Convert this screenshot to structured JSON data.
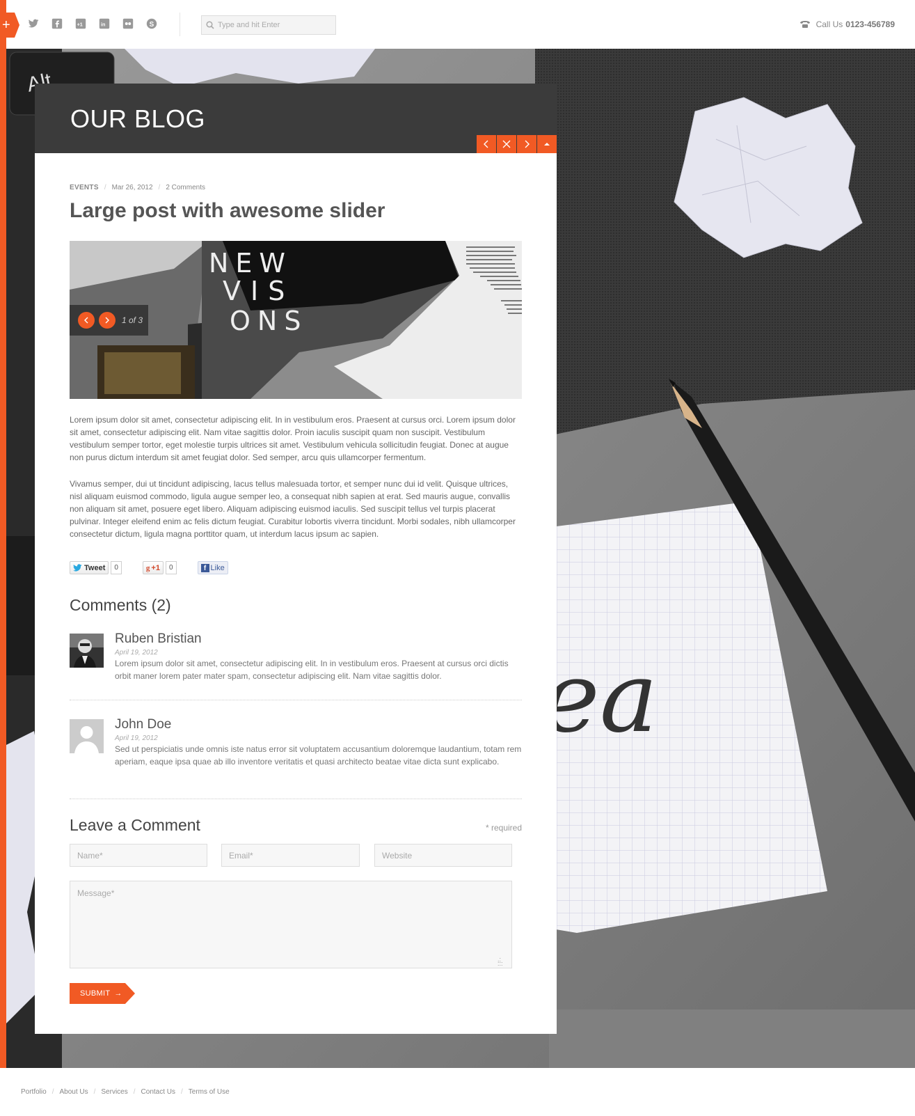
{
  "header": {
    "search_placeholder": "Type and hit Enter",
    "call_label": "Call Us",
    "phone": "0123-456789",
    "socials": [
      "twitter-icon",
      "facebook-icon",
      "google-plus-icon",
      "linkedin-icon",
      "flickr-icon",
      "skype-icon"
    ]
  },
  "blog": {
    "title": "OUR BLOG",
    "controls": [
      "previous-arrow-icon",
      "close-icon",
      "next-arrow-icon",
      "scroll-up-icon"
    ]
  },
  "post": {
    "category": "EVENTS",
    "date": "Mar 26, 2012",
    "comments_link": "2 Comments",
    "title": "Large post with awesome slider",
    "slider_counter": "1 of 3",
    "slider_text": {
      "line1": "NEW",
      "line2": "VIS",
      "line3": "ONS"
    },
    "paragraphs": [
      "Lorem ipsum dolor sit amet, consectetur adipiscing elit. In in vestibulum eros. Praesent at cursus orci. Lorem ipsum dolor sit amet, consectetur adipiscing elit. Nam vitae sagittis dolor. Proin iaculis suscipit quam non suscipit. Vestibulum vestibulum semper tortor, eget molestie turpis ultrices sit amet. Vestibulum vehicula sollicitudin feugiat. Donec at augue non purus dictum interdum sit amet feugiat dolor. Sed semper, arcu quis ullamcorper fermentum.",
      "Vivamus semper, dui ut tincidunt adipiscing, lacus tellus malesuada tortor, et semper nunc dui id velit. Quisque ultrices, nisl aliquam euismod commodo, ligula augue semper leo, a consequat nibh sapien at erat. Sed mauris augue, convallis non aliquam sit amet, posuere eget libero. Aliquam adipiscing euismod iaculis. Sed suscipit tellus vel turpis placerat pulvinar. Integer eleifend enim ac felis dictum feugiat. Curabitur lobortis viverra tincidunt. Morbi sodales, nibh ullamcorper consectetur dictum, ligula magna porttitor quam, ut interdum lacus ipsum ac sapien."
    ]
  },
  "share": {
    "tweet_label": "Tweet",
    "tweet_count": "0",
    "gplus_label": "+1",
    "gplus_count": "0",
    "like_label": "Like"
  },
  "comments": {
    "heading": "Comments (2)",
    "items": [
      {
        "name": "Ruben Bristian",
        "date": "April 19, 2012",
        "text": "Lorem ipsum dolor sit amet, consectetur adipiscing elit. In in vestibulum eros. Praesent at cursus orci dictis orbit maner lorem pater mater spam, consectetur adipiscing elit. Nam vitae sagittis dolor."
      },
      {
        "name": "John Doe",
        "date": "April 19, 2012",
        "text": "Sed ut perspiciatis unde omnis iste natus error sit voluptatem accusantium doloremque laudantium, totam rem aperiam, eaque ipsa quae ab illo inventore veritatis et quasi architecto beatae vitae dicta sunt explicabo."
      }
    ]
  },
  "form": {
    "heading": "Leave a Comment",
    "required_note": "* required",
    "name_placeholder": "Name*",
    "email_placeholder": "Email*",
    "website_placeholder": "Website",
    "message_placeholder": "Message*",
    "submit_label": "SUBMIT",
    "submit_arrow": "→"
  },
  "footer": {
    "links": [
      "Portfolio",
      "About Us",
      "Services",
      "Contact Us",
      "Terms of Use"
    ]
  },
  "background_text": {
    "keyboard_key": "Alt",
    "note_text": "ea"
  },
  "colors": {
    "accent": "#f15a24",
    "header_dark": "#3b3b3b"
  }
}
